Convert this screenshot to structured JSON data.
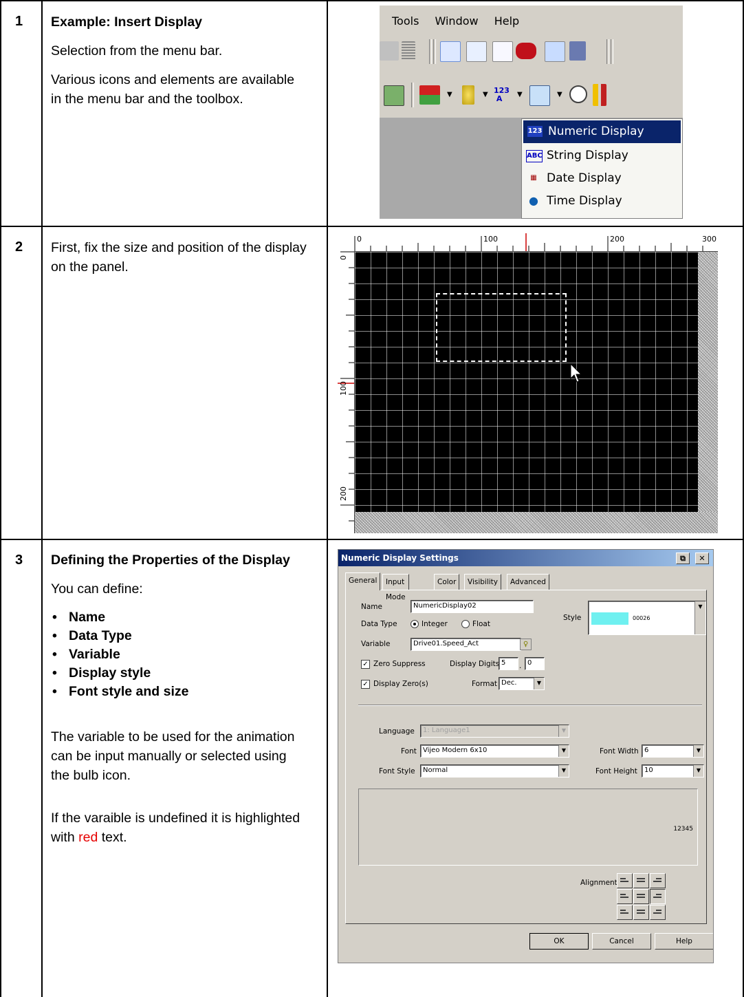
{
  "rows": [
    {
      "number": "1",
      "title": "Example: Insert Display",
      "paragraphs": [
        "Selection from the menu bar.",
        "Various icons and elements are available in the menu bar and the toolbox."
      ]
    },
    {
      "number": "2",
      "paragraphs": [
        "First, fix the size and position of the display on the panel."
      ]
    },
    {
      "number": "3",
      "title": "Defining the Properties of the Display",
      "intro": "You can define:",
      "bullets": [
        "Name",
        "Data Type",
        "Variable",
        "Display style",
        "Font style and size"
      ],
      "para1": "The variable to be used for the animation can be input manually or selected using the bulb icon.",
      "para2_before": "If the varaible is undefined it is highlighted with ",
      "para2_red": "red",
      "para2_after": " text."
    }
  ],
  "menu_screenshot": {
    "menubar": [
      "Tools",
      "Window",
      "Help"
    ],
    "dropdown": [
      {
        "label": "Numeric Display",
        "icon": "numeric-display-icon",
        "badge": "123",
        "selected": true
      },
      {
        "label": "String Display",
        "icon": "string-display-icon",
        "badge": "ABC",
        "selected": false
      },
      {
        "label": "Date Display",
        "icon": "date-display-icon",
        "badge": "▦",
        "selected": false
      },
      {
        "label": "Time Display",
        "icon": "time-display-icon",
        "badge": "●",
        "selected": false
      }
    ]
  },
  "panel_screenshot": {
    "ruler_top": [
      "0",
      "100",
      "200",
      "300"
    ],
    "ruler_left": [
      "0",
      "100",
      "200"
    ]
  },
  "dialog": {
    "title": "Numeric Display Settings",
    "tabs": [
      "General",
      "Input Mode",
      "Color",
      "Visibility",
      "Advanced"
    ],
    "name_label": "Name",
    "name_value": "NumericDisplay02",
    "style_label": "Style",
    "style_preview_value": "00026",
    "data_type_label": "Data Type",
    "integer_label": "Integer",
    "float_label": "Float",
    "variable_label": "Variable",
    "variable_value": "Drive01.Speed_Act",
    "zero_suppress_label": "Zero Suppress",
    "display_digits_label": "Display Digits",
    "display_digits_int": "5",
    "display_digits_dec": "0",
    "display_zeros_label": "Display Zero(s)",
    "format_label": "Format",
    "format_value": "Dec.",
    "language_label": "Language",
    "language_value": "1: Language1",
    "font_label": "Font",
    "font_value": "Vijeo Modern 6x10",
    "font_width_label": "Font Width",
    "font_width_value": "6",
    "font_style_label": "Font Style",
    "font_style_value": "Normal",
    "font_height_label": "Font Height",
    "font_height_value": "10",
    "preview_value": "12345",
    "alignment_label": "Alignment",
    "ok_label": "OK",
    "cancel_label": "Cancel",
    "help_label": "Help"
  },
  "colors": {
    "menu_highlight": "#0a246a",
    "style_swatch": "#6ff0f0",
    "red_text": "#e60000",
    "ruler_marker": "#cc0000"
  }
}
